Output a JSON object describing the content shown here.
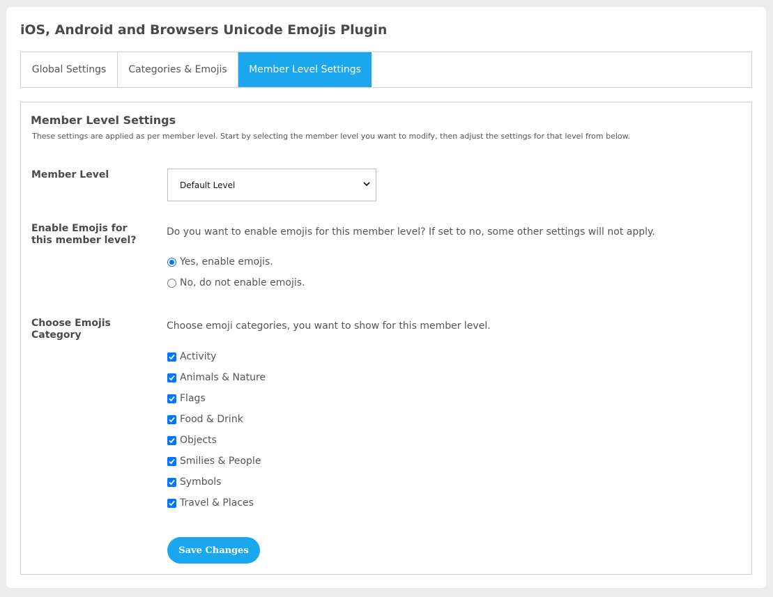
{
  "page": {
    "title": "iOS, Android and Browsers Unicode Emojis Plugin"
  },
  "tabs": [
    {
      "label": "Global Settings",
      "active": false
    },
    {
      "label": "Categories & Emojis",
      "active": false
    },
    {
      "label": "Member Level Settings",
      "active": true
    }
  ],
  "form": {
    "title": "Member Level Settings",
    "description": "These settings are applied as per member level. Start by selecting the member level you want to modify, then adjust the settings for that level from below.",
    "member_level": {
      "label": "Member Level",
      "selected": "Default Level"
    },
    "enable_emojis": {
      "label": "Enable Emojis for this member level?",
      "question": "Do you want to enable emojis for this member level? If set to no, some other settings will not apply.",
      "options": [
        {
          "label": "Yes, enable emojis.",
          "checked": true
        },
        {
          "label": "No, do not enable emojis.",
          "checked": false
        }
      ]
    },
    "categories": {
      "label": "Choose Emojis Category",
      "question": "Choose emoji categories, you want to show for this member level.",
      "options": [
        {
          "label": "Activity",
          "checked": true
        },
        {
          "label": "Animals & Nature",
          "checked": true
        },
        {
          "label": "Flags",
          "checked": true
        },
        {
          "label": "Food & Drink",
          "checked": true
        },
        {
          "label": "Objects",
          "checked": true
        },
        {
          "label": "Smilies & People",
          "checked": true
        },
        {
          "label": "Symbols",
          "checked": true
        },
        {
          "label": "Travel & Places",
          "checked": true
        }
      ]
    },
    "save_label": "Save Changes"
  },
  "colors": {
    "accent": "#1aa7ee",
    "control_blue": "#0075ff",
    "background": "#ececec"
  }
}
